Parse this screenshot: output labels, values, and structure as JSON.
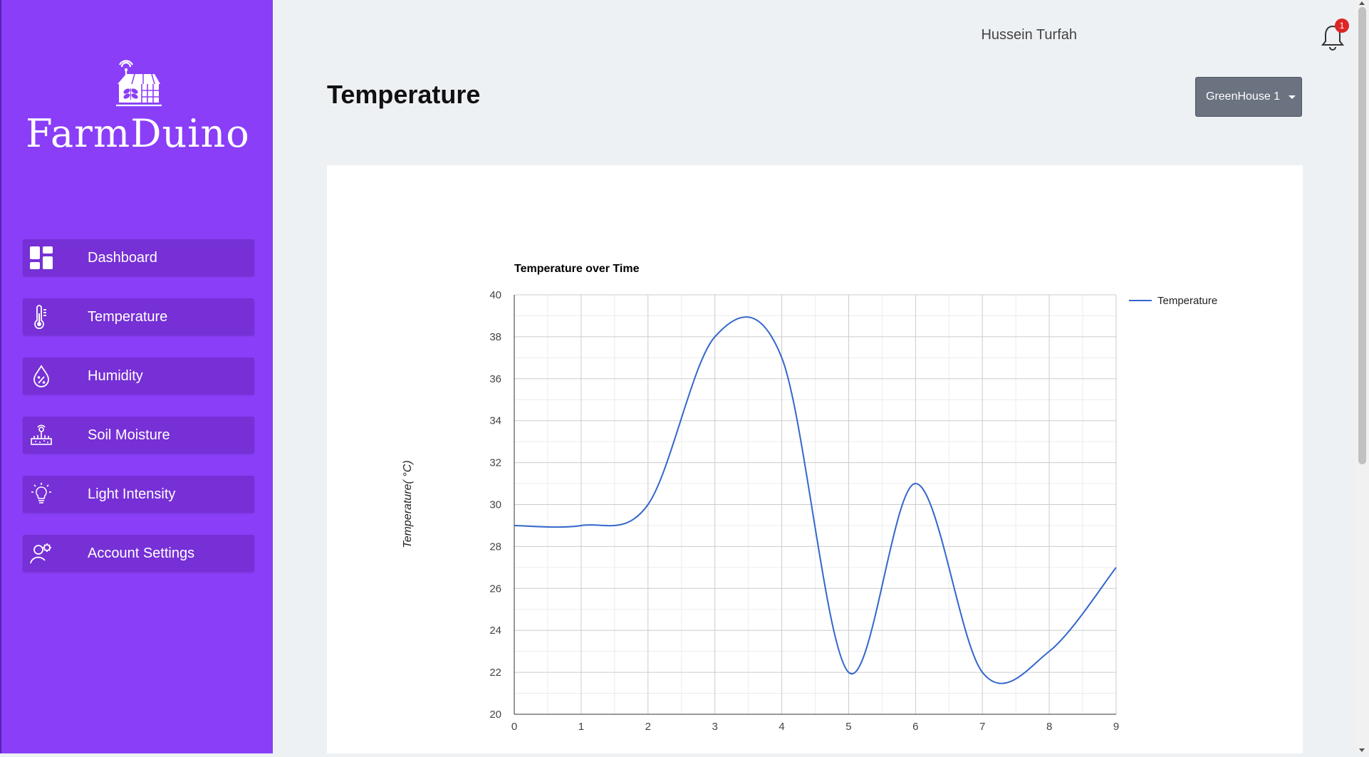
{
  "brand": {
    "name": "FarmDuino",
    "icon": "greenhouse-logo-icon"
  },
  "sidebar": {
    "items": [
      {
        "label": "Dashboard",
        "icon": "dashboard-icon"
      },
      {
        "label": "Temperature",
        "icon": "thermometer-icon"
      },
      {
        "label": "Humidity",
        "icon": "humidity-drop-icon"
      },
      {
        "label": "Soil Moisture",
        "icon": "soil-moisture-icon"
      },
      {
        "label": "Light Intensity",
        "icon": "lightbulb-icon"
      },
      {
        "label": "Account Settings",
        "icon": "user-gear-icon"
      }
    ]
  },
  "header": {
    "user_name": "Hussein Turfah",
    "notification_count": "1",
    "page_title": "Temperature",
    "greenhouse_select": "GreenHouse 1"
  },
  "colors": {
    "sidebar": "#8a3ef8",
    "nav_item": "#7630d6",
    "line": "#3366cc",
    "badge": "#dc2626"
  },
  "chart_data": {
    "type": "line",
    "title": "Temperature over Time",
    "xlabel": "",
    "ylabel": "Temperature( °C)",
    "x": [
      0,
      1,
      2,
      3,
      4,
      5,
      6,
      7,
      8,
      9
    ],
    "series": [
      {
        "name": "Temperature",
        "values": [
          29,
          29,
          30,
          38,
          37,
          22,
          31,
          22,
          23,
          27
        ],
        "color": "#3366cc"
      }
    ],
    "xlim": [
      0,
      9
    ],
    "ylim": [
      20,
      40
    ],
    "xticks": [
      0,
      1,
      2,
      3,
      4,
      5,
      6,
      7,
      8,
      9
    ],
    "yticks": [
      20,
      22,
      24,
      26,
      28,
      30,
      32,
      34,
      36,
      38,
      40
    ],
    "grid": true,
    "legend": "right"
  }
}
